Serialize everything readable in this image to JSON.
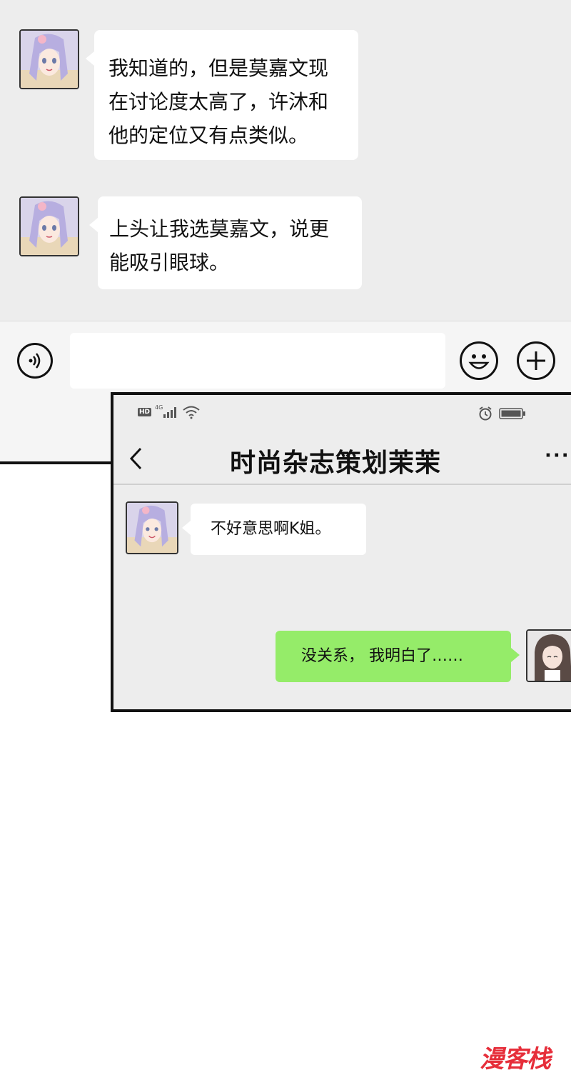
{
  "chat_top": {
    "messages": [
      {
        "sender": "other",
        "text_lines": [
          "我知道的，但是莫嘉文现",
          "在讨论度太高了，许沐和",
          "他的定位又有点类似。"
        ]
      },
      {
        "sender": "other",
        "text_lines": [
          "上头让我选莫嘉文，说更",
          "能吸引眼球。"
        ]
      }
    ],
    "input_bar": {
      "voice_icon": "voice-icon",
      "emoji_icon": "emoji-icon",
      "plus_icon": "plus-icon",
      "input_value": ""
    }
  },
  "chat_front": {
    "status_bar": {
      "hd": "HD",
      "network": "4G",
      "signal_icon": "signal-icon",
      "wifi_icon": "wifi-icon",
      "alarm_icon": "alarm-icon",
      "battery_icon": "battery-icon"
    },
    "nav": {
      "back_icon": "back-icon",
      "title": "时尚杂志策划茉茉",
      "more_label": "···"
    },
    "messages": [
      {
        "sender": "other",
        "text": "不好意思啊K姐。"
      },
      {
        "sender": "self",
        "text": "没关系， 我明白了……"
      }
    ]
  },
  "watermark": {
    "text": "漫客栈"
  },
  "colors": {
    "chat_bg": "#ededed",
    "self_bubble": "#95ec69",
    "other_bubble": "#ffffff",
    "watermark": "#e62e3a"
  }
}
